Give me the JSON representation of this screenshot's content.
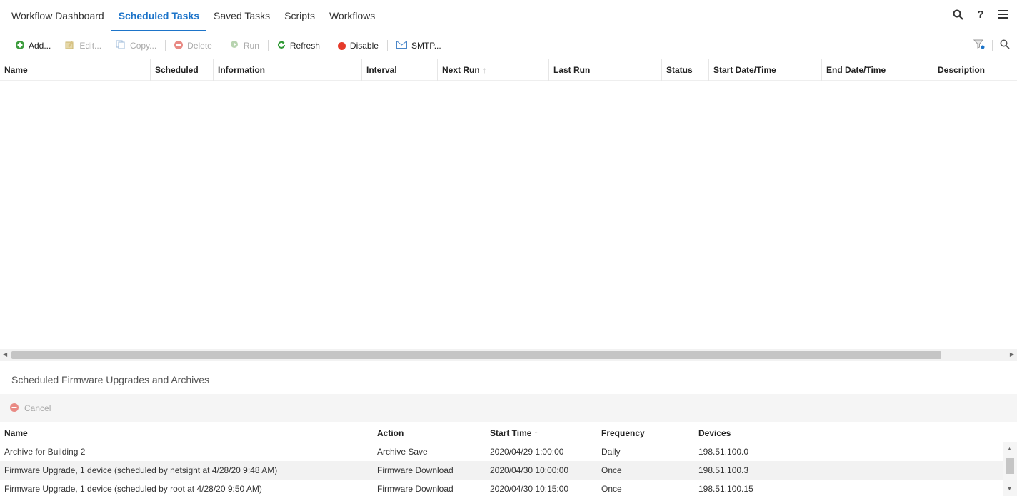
{
  "nav": {
    "tabs": [
      {
        "label": "Workflow Dashboard"
      },
      {
        "label": "Scheduled Tasks"
      },
      {
        "label": "Saved Tasks"
      },
      {
        "label": "Scripts"
      },
      {
        "label": "Workflows"
      }
    ],
    "active_tab": "Scheduled Tasks",
    "help_label": "?"
  },
  "toolbar": {
    "add": "Add...",
    "edit": "Edit...",
    "copy": "Copy...",
    "delete": "Delete",
    "run": "Run",
    "refresh": "Refresh",
    "disable": "Disable",
    "smtp": "SMTP..."
  },
  "grid": {
    "columns": [
      "Name",
      "Scheduled",
      "Information",
      "Interval",
      "Next Run ↑",
      "Last Run",
      "Status",
      "Start Date/Time",
      "End Date/Time",
      "Description"
    ]
  },
  "lower_panel": {
    "title": "Scheduled Firmware Upgrades and Archives",
    "cancel_label": "Cancel",
    "columns": [
      "Name",
      "Action",
      "Start Time ↑",
      "Frequency",
      "Devices"
    ],
    "rows": [
      {
        "name": "Archive for Building 2",
        "action": "Archive Save",
        "start_time": "2020/04/29 1:00:00",
        "frequency": "Daily",
        "devices": "198.51.100.0"
      },
      {
        "name": "Firmware Upgrade, 1 device (scheduled by netsight at 4/28/20 9:48 AM)",
        "action": "Firmware Download",
        "start_time": "2020/04/30 10:00:00",
        "frequency": "Once",
        "devices": "198.51.100.3"
      },
      {
        "name": "Firmware Upgrade, 1 device (scheduled by root at 4/28/20 9:50 AM)",
        "action": "Firmware Download",
        "start_time": "2020/04/30 10:15:00",
        "frequency": "Once",
        "devices": "198.51.100.15"
      }
    ]
  },
  "colors": {
    "accent": "#1d74c9",
    "add_green": "#3a9b3a",
    "delete_red": "#e0463c",
    "disable_red": "#e53a2a",
    "refresh_green": "#2f9a35",
    "smtp_blue": "#4a86c8"
  }
}
